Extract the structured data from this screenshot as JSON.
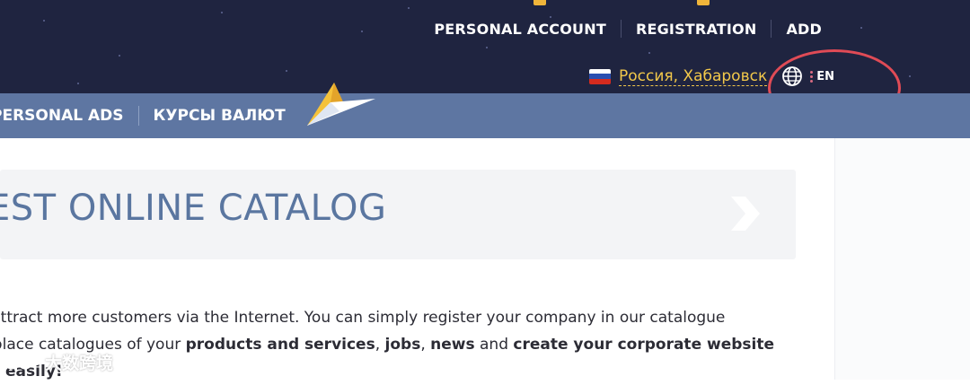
{
  "header": {
    "nav": [
      "PERSONAL ACCOUNT",
      "REGISTRATION",
      "ADD"
    ],
    "region": "Россия, Хабаровск",
    "language": "EN"
  },
  "menu": {
    "items": [
      "PERSONAL ADS",
      "КУРСЫ ВАЛЮТ"
    ]
  },
  "banner": {
    "title": "EST ONLINE CATALOG"
  },
  "content": {
    "line1": "s attract more customers via the Internet. You can simply register your company in our catalogue",
    "line2_a": "o place catalogues of your ",
    "line2_b": "products and services",
    "line2_c": ", ",
    "line2_d": "jobs",
    "line2_e": ", ",
    "line2_f": "news",
    "line2_g": " and ",
    "line2_h": "create your corporate website",
    "line3": "easily!"
  },
  "watermark": {
    "text": "大数跨境"
  },
  "colors": {
    "header_bg": "#1f2440",
    "nav_bg": "#5e76a2",
    "accent_yellow": "#f2c84a",
    "annotation_red": "#e04b56",
    "title_blue": "#5a76a0"
  }
}
